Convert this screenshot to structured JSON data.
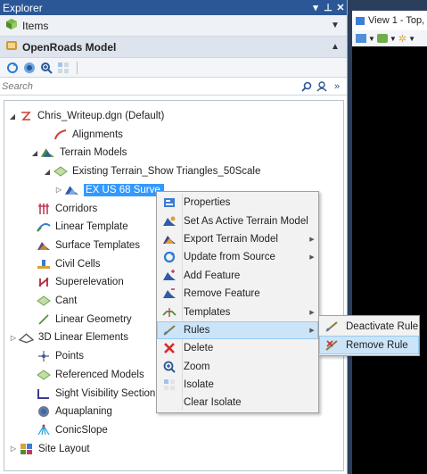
{
  "panel": {
    "title": "Explorer",
    "title_controls": [
      "▾",
      "⊥",
      "✕"
    ],
    "items_section": {
      "label": "Items"
    },
    "model_section": {
      "label": "OpenRoads Model"
    },
    "search": {
      "placeholder": "Search"
    }
  },
  "tree": [
    {
      "label": "Chris_Writeup.dgn (Default)",
      "icon": "dgn-file-icon",
      "arrow": "expanded"
    },
    {
      "label": "Alignments",
      "icon": "alignment-icon",
      "arrow": "none"
    },
    {
      "label": "Terrain Models",
      "icon": "terrain-models-icon",
      "arrow": "expanded"
    },
    {
      "label": "Existing Terrain_Show Triangles_50Scale",
      "icon": "terrain-surface-icon",
      "arrow": "expanded"
    },
    {
      "label": "EX US 68 Surve",
      "icon": "terrain-model-icon",
      "arrow": "collapsed",
      "selected": true
    },
    {
      "label": "Corridors",
      "icon": "corridor-icon",
      "arrow": "none"
    },
    {
      "label": "Linear Template",
      "icon": "linear-template-icon",
      "arrow": "none"
    },
    {
      "label": "Surface Templates",
      "icon": "surface-template-icon",
      "arrow": "none"
    },
    {
      "label": "Civil Cells",
      "icon": "civil-cells-icon",
      "arrow": "none"
    },
    {
      "label": "Superelevation",
      "icon": "superelevation-icon",
      "arrow": "none"
    },
    {
      "label": "Cant",
      "icon": "cant-icon",
      "arrow": "none"
    },
    {
      "label": "Linear Geometry",
      "icon": "linear-geometry-icon",
      "arrow": "none"
    },
    {
      "label": "3D Linear Elements",
      "icon": "linear-3d-icon",
      "arrow": "collapsed"
    },
    {
      "label": "Points",
      "icon": "points-icon",
      "arrow": "none"
    },
    {
      "label": "Referenced Models",
      "icon": "referenced-models-icon",
      "arrow": "none"
    },
    {
      "label": "Sight Visibility Section",
      "icon": "sight-visibility-icon",
      "arrow": "none"
    },
    {
      "label": "Aquaplaning",
      "icon": "aquaplaning-icon",
      "arrow": "none"
    },
    {
      "label": "ConicSlope",
      "icon": "conic-slope-icon",
      "arrow": "none"
    },
    {
      "label": "Site Layout",
      "icon": "site-layout-icon",
      "arrow": "collapsed"
    }
  ],
  "context_menu": [
    {
      "label": "Properties",
      "icon": "properties-icon",
      "submenu": false
    },
    {
      "label": "Set As Active Terrain Model",
      "icon": "set-active-terrain-icon",
      "submenu": false
    },
    {
      "label": "Export Terrain Model",
      "icon": "export-terrain-icon",
      "submenu": true
    },
    {
      "label": "Update from Source",
      "icon": "update-source-icon",
      "submenu": true
    },
    {
      "label": "Add Feature",
      "icon": "add-feature-icon",
      "submenu": false
    },
    {
      "label": "Remove Feature",
      "icon": "remove-feature-icon",
      "submenu": false
    },
    {
      "label": "Templates",
      "icon": "templates-icon",
      "submenu": true
    },
    {
      "label": "Rules",
      "icon": "rules-icon",
      "submenu": true,
      "hover": true
    },
    {
      "label": "Delete",
      "icon": "delete-icon",
      "submenu": false
    },
    {
      "label": "Zoom",
      "icon": "zoom-icon",
      "submenu": false
    },
    {
      "label": "Isolate",
      "icon": "isolate-icon",
      "submenu": false
    },
    {
      "label": "Clear Isolate",
      "icon": "",
      "submenu": false
    }
  ],
  "rules_submenu": [
    {
      "label": "Deactivate Rule",
      "icon": "deactivate-rule-icon"
    },
    {
      "label": "Remove Rule",
      "icon": "remove-rule-icon",
      "hover": true
    }
  ],
  "viewport": {
    "tab_label": "View 1 - Top,"
  },
  "colors": {
    "title_bar": "#2b5797",
    "selection": "#3399ff",
    "menu_hover": "#cce4f7",
    "viewport_bg": "#000000"
  }
}
